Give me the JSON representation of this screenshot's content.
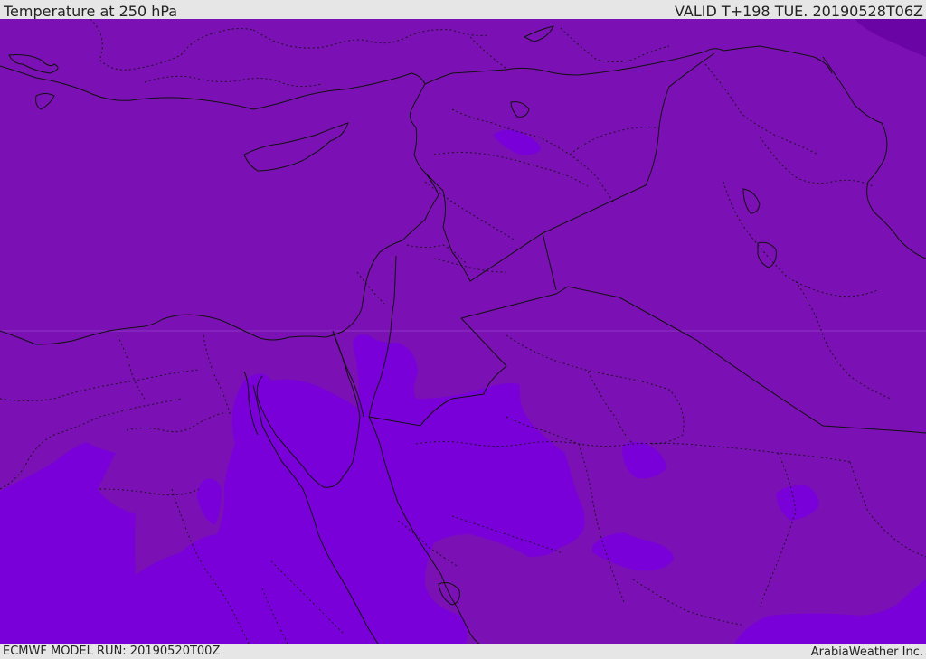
{
  "header": {
    "title": "Temperature at 250 hPa",
    "valid_time": "VALID T+198 TUE. 20190528T06Z"
  },
  "footer": {
    "model_run": "ECMWF MODEL RUN: 20190520T00Z",
    "credit": "ArabiaWeather Inc."
  },
  "map": {
    "field": "temperature",
    "level": "250 hPa",
    "colors": {
      "base_band": "#7b10b4",
      "cold_band": "#7a00da",
      "dark_band": "#6a04a5",
      "borders": "#111111"
    }
  }
}
